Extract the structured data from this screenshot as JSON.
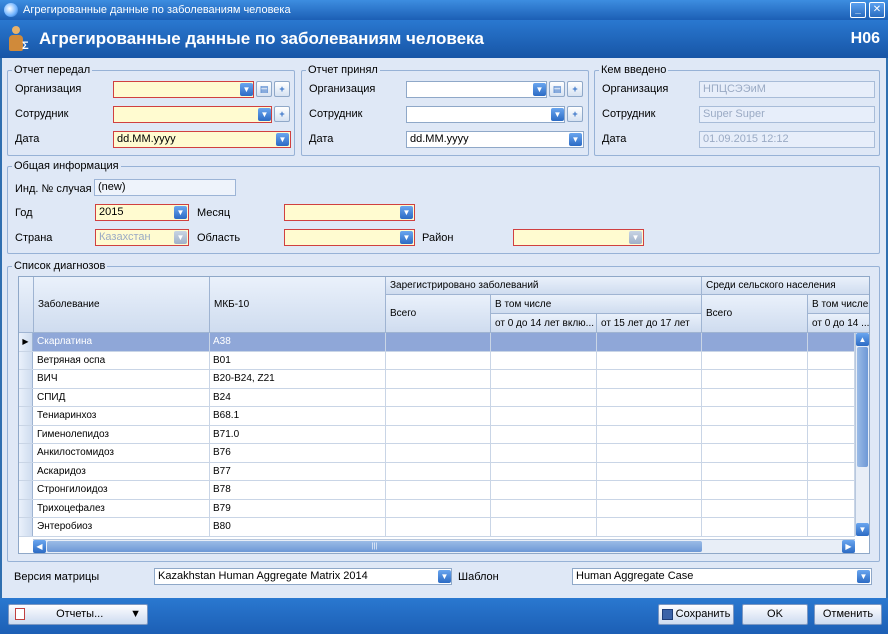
{
  "window": {
    "title": "Агрегированные данные по заболеваниям человека"
  },
  "header": {
    "title": "Агрегированные данные по заболеваниям человека",
    "code": "H06"
  },
  "sent": {
    "legend": "Отчет передал",
    "org_label": "Организация",
    "org_value": "",
    "emp_label": "Сотрудник",
    "emp_value": "",
    "date_label": "Дата",
    "date_value": "dd.MM.yyyy"
  },
  "received": {
    "legend": "Отчет принял",
    "org_label": "Организация",
    "org_value": "",
    "emp_label": "Сотрудник",
    "emp_value": "",
    "date_label": "Дата",
    "date_value": "dd.MM.yyyy"
  },
  "entered": {
    "legend": "Кем введено",
    "org_label": "Организация",
    "org_value": "НПЦСЭЭиМ",
    "emp_label": "Сотрудник",
    "emp_value": "Super Super",
    "date_label": "Дата",
    "date_value": "01.09.2015 12:12"
  },
  "general": {
    "legend": "Общая информация",
    "case_label": "Инд. № случая",
    "case_value": "(new)",
    "year_label": "Год",
    "year_value": "2015",
    "month_label": "Месяц",
    "month_value": "",
    "country_label": "Страна",
    "country_value": "Казахстан",
    "region_label": "Область",
    "region_value": "",
    "district_label": "Район",
    "district_value": ""
  },
  "diagnoses": {
    "legend": "Список диагнозов",
    "headers": {
      "disease": "Заболевание",
      "icd": "МКБ-10",
      "registered": "Зарегистрировано заболеваний",
      "total": "Всего",
      "including": "В том числе",
      "age_0_14": "от 0 до 14 лет вклю...",
      "age_15_17": "от 15 лет до 17 лет",
      "rural": "Среди сельского населения",
      "total2": "Всего",
      "including2": "В том числе",
      "age_0_14_2": "от 0 до 14 ..."
    },
    "rows": [
      {
        "disease": "Скарлатина",
        "icd": "A38"
      },
      {
        "disease": "Ветряная оспа",
        "icd": "B01"
      },
      {
        "disease": "ВИЧ",
        "icd": "B20-B24, Z21"
      },
      {
        "disease": "СПИД",
        "icd": "B24"
      },
      {
        "disease": "Тениаринхоз",
        "icd": "B68.1"
      },
      {
        "disease": "Гименолепидоз",
        "icd": "B71.0"
      },
      {
        "disease": "Анкилостомидоз",
        "icd": "B76"
      },
      {
        "disease": "Аскаридоз",
        "icd": "B77"
      },
      {
        "disease": "Стронгилоидоз",
        "icd": "B78"
      },
      {
        "disease": "Трихоцефалез",
        "icd": "B79"
      },
      {
        "disease": "Энтеробиоз",
        "icd": "B80"
      }
    ]
  },
  "matrix": {
    "version_label": "Версия матрицы",
    "version_value": "Kazakhstan Human Aggregate Matrix 2014",
    "template_label": "Шаблон",
    "template_value": "Human Aggregate Case"
  },
  "footer": {
    "reports": "Отчеты...",
    "save": "Сохранить",
    "ok": "OK",
    "cancel": "Отменить"
  }
}
